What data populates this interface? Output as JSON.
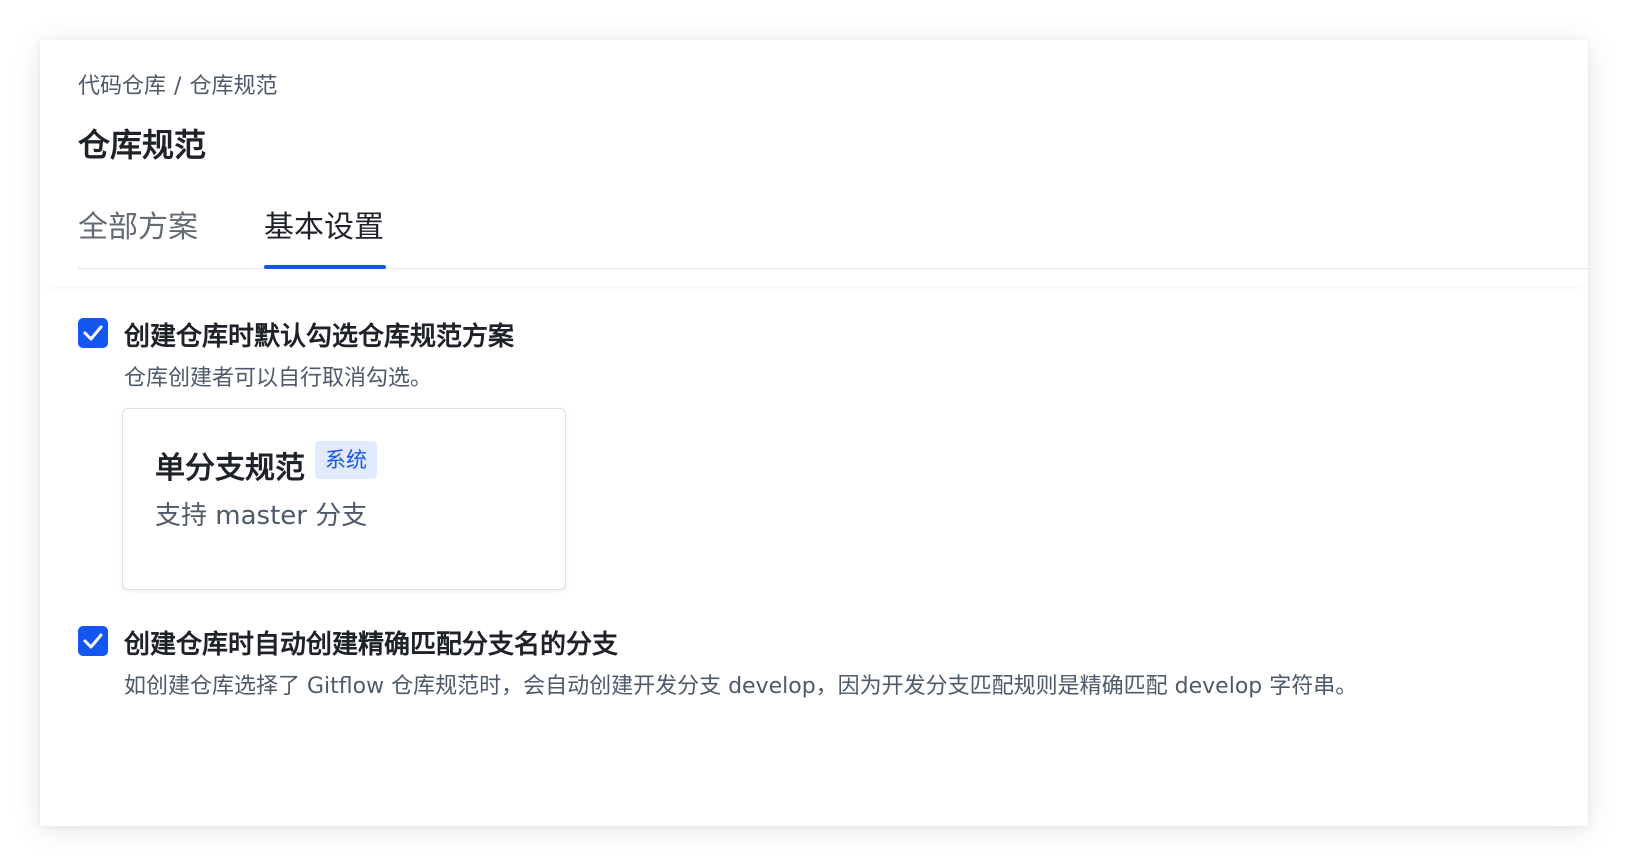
{
  "breadcrumb": {
    "parent": "代码仓库",
    "separator": "/",
    "current": "仓库规范"
  },
  "page": {
    "title": "仓库规范"
  },
  "tabs": [
    {
      "label": "全部方案",
      "active": false
    },
    {
      "label": "基本设置",
      "active": true
    }
  ],
  "options": [
    {
      "checked": true,
      "title": "创建仓库时默认勾选仓库规范方案",
      "description": "仓库创建者可以自行取消勾选。"
    },
    {
      "checked": true,
      "title": "创建仓库时自动创建精确匹配分支名的分支",
      "description": "如创建仓库选择了 Gitflow 仓库规范时，会自动创建开发分支 develop，因为开发分支匹配规则是精确匹配 develop 字符串。"
    }
  ],
  "card": {
    "title": "单分支规范",
    "badge": "系统",
    "description": "支持 master 分支"
  },
  "colors": {
    "accent": "#1456f0",
    "badge_bg": "#e1eaff",
    "text_primary": "#1f2329",
    "text_secondary": "#4e5969"
  },
  "icons": {
    "checkbox": "checkmark-icon"
  }
}
